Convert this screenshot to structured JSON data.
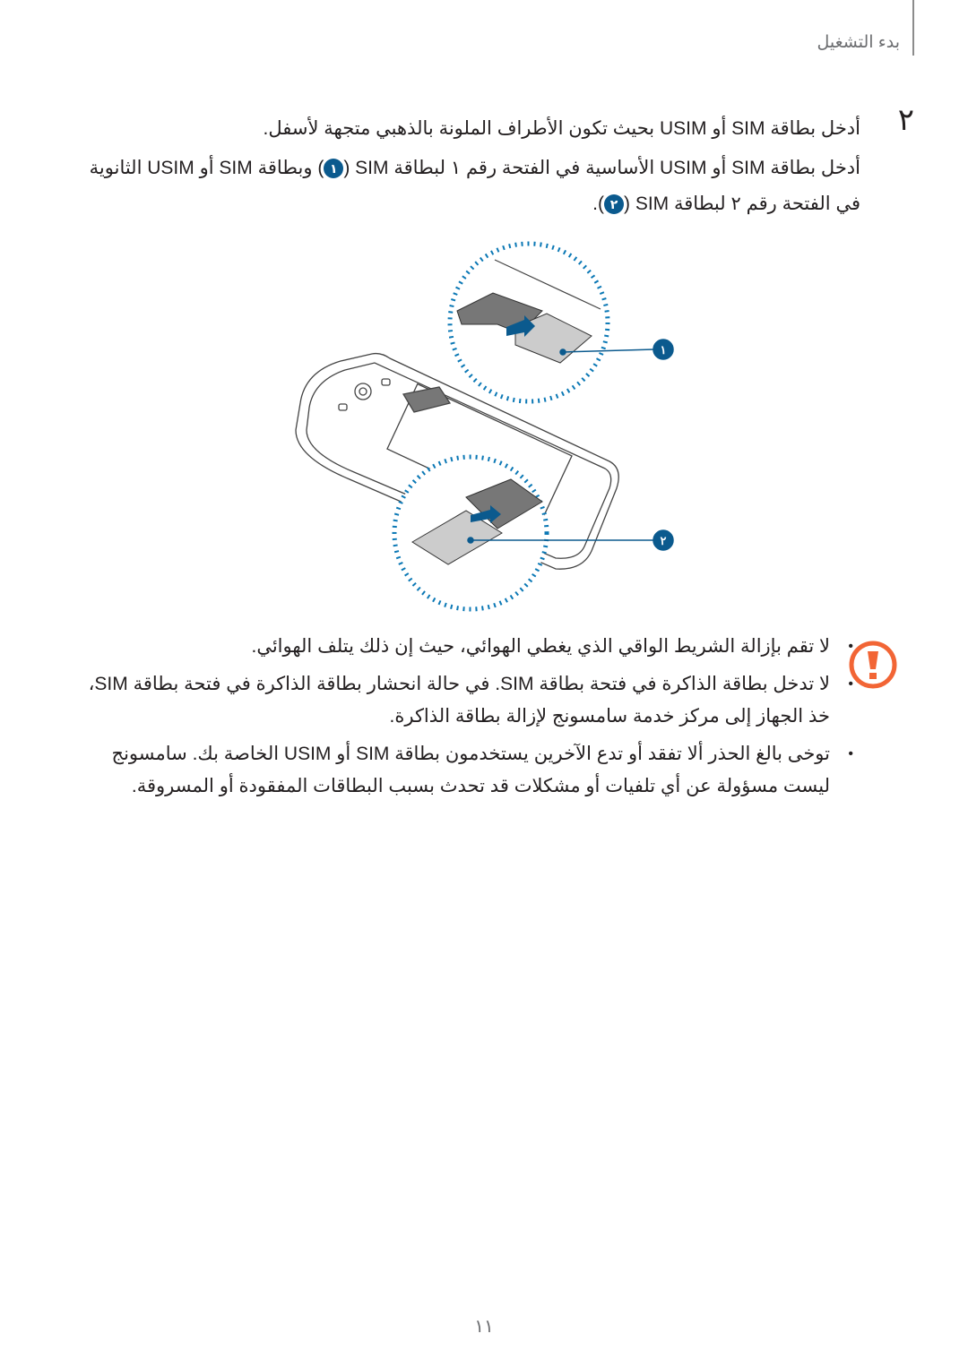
{
  "header": {
    "section_title": "بدء التشغيل"
  },
  "step": {
    "number": "٢",
    "instruction": "أدخل بطاقة SIM أو USIM بحيث تكون الأطراف الملونة بالذهبي متجهة لأسفل.",
    "detail_part1": "أدخل بطاقة SIM أو USIM الأساسية في الفتحة رقم ١ لبطاقة SIM (",
    "detail_badge1": "١",
    "detail_part2": ") وبطاقة SIM أو USIM الثانوية في الفتحة رقم ٢ لبطاقة SIM (",
    "detail_badge2": "٢",
    "detail_part3": ")."
  },
  "figure": {
    "callouts": [
      "١",
      "٢"
    ],
    "accent_color": "#0b5a8e"
  },
  "warnings": {
    "icon": "caution-icon",
    "icon_color": "#f26535",
    "items": [
      "لا تقم بإزالة الشريط الواقي الذي يغطي الهوائي، حيث إن ذلك يتلف الهوائي.",
      "لا تدخل بطاقة الذاكرة في فتحة بطاقة SIM. في حالة انحشار بطاقة الذاكرة في فتحة بطاقة SIM، خذ الجهاز إلى مركز خدمة سامسونج لإزالة بطاقة الذاكرة.",
      "توخى بالغ الحذر ألا تفقد أو تدع الآخرين يستخدمون بطاقة SIM أو USIM الخاصة بك. سامسونج ليست مسؤولة عن أي تلفيات أو مشكلات قد تحدث بسبب البطاقات المفقودة أو المسروقة."
    ]
  },
  "footer": {
    "page_number": "١١"
  }
}
